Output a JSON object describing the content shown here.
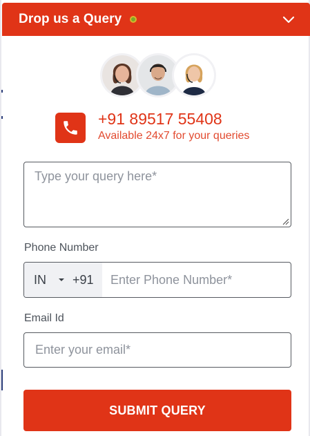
{
  "header": {
    "title": "Drop us a Query",
    "status_icon": "online-status-dot",
    "toggle_icon": "chevron-down-icon"
  },
  "contact": {
    "phone": "+91 89517 55408",
    "availability": "Available 24x7 for your queries",
    "icon": "phone-icon"
  },
  "form": {
    "query_placeholder": "Type your query here*",
    "phone_label": "Phone Number",
    "country_code": "IN",
    "dial_code": "+91",
    "phone_placeholder": "Enter Phone Number*",
    "email_label": "Email Id",
    "email_placeholder": "Enter your email*",
    "submit_label": "SUBMIT QUERY"
  },
  "colors": {
    "accent": "#e03417",
    "status_dot": "#7aa92a"
  }
}
